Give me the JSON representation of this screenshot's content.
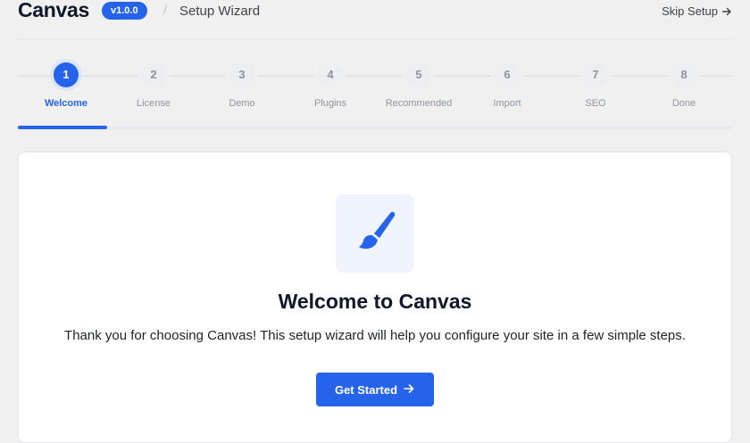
{
  "header": {
    "brand": "Canvas",
    "version": "v1.0.0",
    "separator": "/",
    "title": "Setup Wizard",
    "skip_label": "Skip Setup",
    "skip_icon": "arrow-right-icon"
  },
  "steps": [
    {
      "number": "1",
      "label": "Welcome",
      "active": true
    },
    {
      "number": "2",
      "label": "License",
      "active": false
    },
    {
      "number": "3",
      "label": "Demo",
      "active": false
    },
    {
      "number": "4",
      "label": "Plugins",
      "active": false
    },
    {
      "number": "5",
      "label": "Recommended",
      "active": false
    },
    {
      "number": "6",
      "label": "Import",
      "active": false
    },
    {
      "number": "7",
      "label": "SEO",
      "active": false
    },
    {
      "number": "8",
      "label": "Done",
      "active": false
    }
  ],
  "progress": {
    "fraction": 0.125
  },
  "welcome": {
    "icon": "paintbrush-icon",
    "title": "Welcome to Canvas",
    "text": "Thank you for choosing Canvas! This setup wizard will help you configure your site in a few simple steps.",
    "cta_label": "Get Started",
    "cta_icon": "arrow-right-icon"
  },
  "colors": {
    "accent": "#2563eb",
    "background": "#f0f0f1",
    "card": "#ffffff",
    "icon_tile": "#eff4ff"
  }
}
